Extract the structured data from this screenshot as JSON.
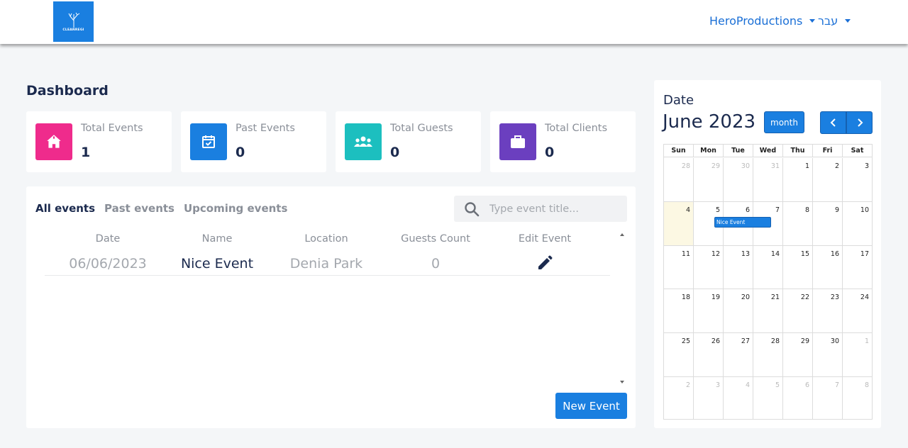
{
  "navbar": {
    "logo_text": "CLEANREGI",
    "account_menu": "HeroProductions",
    "language_menu": "עבר"
  },
  "dashboard": {
    "title": "Dashboard",
    "stats": [
      {
        "label": "Total Events",
        "value": "1",
        "icon": "house-icon",
        "color": "#ef2b8c"
      },
      {
        "label": "Past Events",
        "value": "0",
        "icon": "calendar-check-icon",
        "color": "#1a7fe0"
      },
      {
        "label": "Total Guests",
        "value": "0",
        "icon": "users-icon",
        "color": "#1cbfbf"
      },
      {
        "label": "Total Clients",
        "value": "0",
        "icon": "briefcase-icon",
        "color": "#6b3fbf"
      }
    ]
  },
  "events": {
    "tabs": [
      "All events",
      "Past events",
      "Upcoming events"
    ],
    "active_tab": "All events",
    "search_placeholder": "Type event title...",
    "columns": [
      "Date",
      "Name",
      "Location",
      "Guests Count",
      "Edit Event"
    ],
    "rows": [
      {
        "date": "06/06/2023",
        "name": "Nice Event",
        "location": "Denia Park",
        "guests": "0"
      }
    ],
    "new_event_label": "New Event"
  },
  "calendar": {
    "label": "Date",
    "title": "June 2023",
    "view_button": "month",
    "weekdays": [
      "Sun",
      "Mon",
      "Tue",
      "Wed",
      "Thu",
      "Fri",
      "Sat"
    ],
    "weeks": [
      [
        "28",
        "29",
        "30",
        "31",
        "1",
        "2",
        "3"
      ],
      [
        "4",
        "5",
        "6",
        "7",
        "8",
        "9",
        "10"
      ],
      [
        "11",
        "12",
        "13",
        "14",
        "15",
        "16",
        "17"
      ],
      [
        "18",
        "19",
        "20",
        "21",
        "22",
        "23",
        "24"
      ],
      [
        "25",
        "26",
        "27",
        "28",
        "29",
        "30",
        "1"
      ],
      [
        "2",
        "3",
        "4",
        "5",
        "6",
        "7",
        "8"
      ]
    ],
    "event_label": "Nice Event"
  },
  "colors": {
    "primary": "#1a7fe0",
    "today_bg": "#fcf8e3"
  }
}
